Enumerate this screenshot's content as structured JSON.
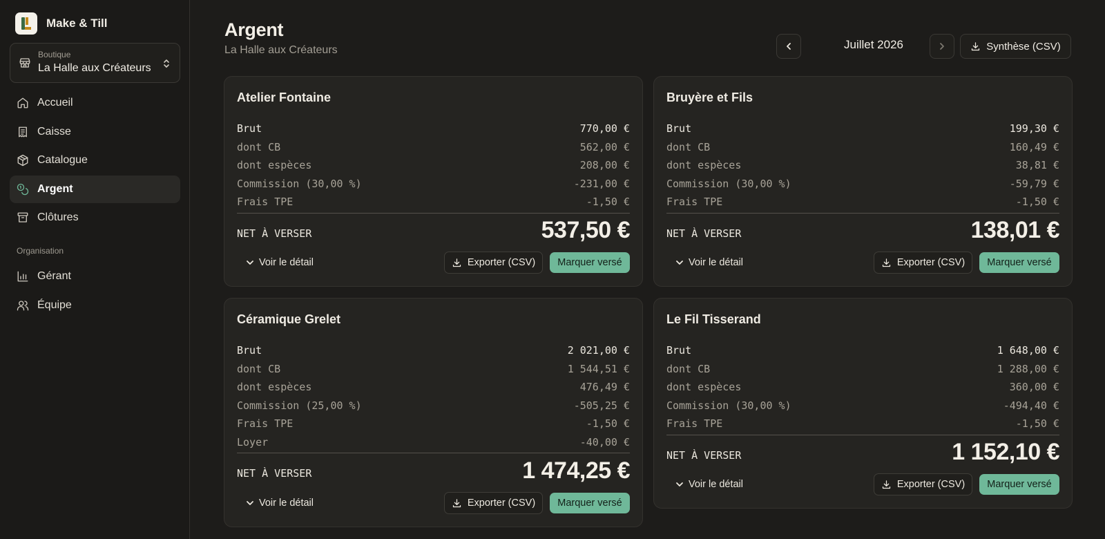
{
  "app": {
    "name": "Make & Till"
  },
  "sidebar": {
    "shop_caption": "Boutique",
    "shop_value": "La Halle aux Créateurs",
    "items": [
      {
        "label": "Accueil",
        "icon": "home-icon"
      },
      {
        "label": "Caisse",
        "icon": "receipt-icon"
      },
      {
        "label": "Catalogue",
        "icon": "package-icon"
      },
      {
        "label": "Argent",
        "icon": "coins-icon",
        "active": true
      },
      {
        "label": "Clôtures",
        "icon": "archive-icon"
      }
    ],
    "section_label": "Organisation",
    "org_items": [
      {
        "label": "Gérant",
        "icon": "bar-chart-icon"
      },
      {
        "label": "Équipe",
        "icon": "users-icon"
      }
    ]
  },
  "header": {
    "title": "Argent",
    "subtitle": "La Halle aux Créateurs",
    "month": "Juillet 2026",
    "summary_button": "Synthèse (CSV)"
  },
  "labels": {
    "net": "NET À VERSER",
    "detail": "Voir le détail",
    "export": "Exporter (CSV)",
    "mark_paid": "Marquer versé"
  },
  "cards": [
    {
      "name": "Atelier Fontaine",
      "rows": [
        {
          "label": "Brut",
          "value": "770,00 €"
        },
        {
          "label": "dont CB",
          "value": "562,00 €"
        },
        {
          "label": "dont espèces",
          "value": "208,00 €"
        },
        {
          "label": "Commission (30,00 %)",
          "value": "-231,00 €"
        },
        {
          "label": "Frais TPE",
          "value": "-1,50 €"
        }
      ],
      "net": "537,50 €"
    },
    {
      "name": "Bruyère et Fils",
      "rows": [
        {
          "label": "Brut",
          "value": "199,30 €"
        },
        {
          "label": "dont CB",
          "value": "160,49 €"
        },
        {
          "label": "dont espèces",
          "value": "38,81 €"
        },
        {
          "label": "Commission (30,00 %)",
          "value": "-59,79 €"
        },
        {
          "label": "Frais TPE",
          "value": "-1,50 €"
        }
      ],
      "net": "138,01 €"
    },
    {
      "name": "Céramique Grelet",
      "rows": [
        {
          "label": "Brut",
          "value": "2 021,00 €"
        },
        {
          "label": "dont CB",
          "value": "1 544,51 €"
        },
        {
          "label": "dont espèces",
          "value": "476,49 €"
        },
        {
          "label": "Commission (25,00 %)",
          "value": "-505,25 €"
        },
        {
          "label": "Frais TPE",
          "value": "-1,50 €"
        },
        {
          "label": "Loyer",
          "value": "-40,00 €"
        }
      ],
      "net": "1 474,25 €"
    },
    {
      "name": "Le Fil Tisserand",
      "rows": [
        {
          "label": "Brut",
          "value": "1 648,00 €"
        },
        {
          "label": "dont CB",
          "value": "1 288,00 €"
        },
        {
          "label": "dont espèces",
          "value": "360,00 €"
        },
        {
          "label": "Commission (30,00 %)",
          "value": "-494,40 €"
        },
        {
          "label": "Frais TPE",
          "value": "-1,50 €"
        }
      ],
      "net": "1 152,10 €"
    }
  ],
  "colors": {
    "accent": "#6fb899",
    "background": "#1d1c1a",
    "card": "#252421"
  }
}
